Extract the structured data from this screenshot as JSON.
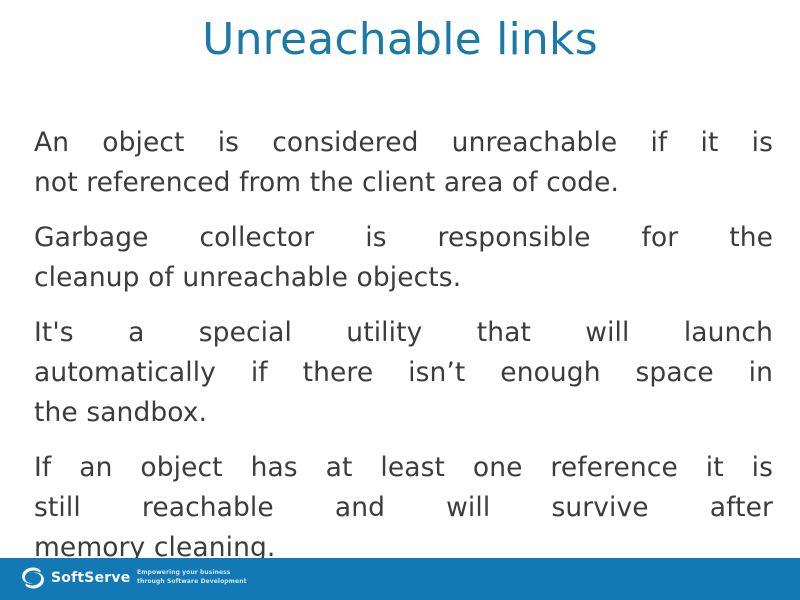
{
  "slide": {
    "title": "Unreachable links",
    "title_color": "#1b7aa8",
    "body_color": "#3c3c3c",
    "background_color": "#ffffff",
    "paragraphs": [
      {
        "text": "An object is considered unreachable if it is not referenced from the client area of code.",
        "lines": [
          "An object is considered unreachable if it is",
          "not referenced from the client area of code."
        ]
      },
      {
        "text": "Garbage collector is responsible for the cleanup of unreachable objects.",
        "lines": [
          "Garbage collector is responsible for the",
          "cleanup of unreachable objects."
        ]
      },
      {
        "text": "It's a special utility that will launch automatically if there isn’t enough space in the sandbox.",
        "lines": [
          "It's a special utility that will launch",
          "automatically if there isn’t enough space in",
          "the sandbox."
        ]
      },
      {
        "text": "If an object has at least one reference it is still reachable and will survive after memory cleaning.",
        "lines": [
          "If an object has at least one reference it is",
          "still reachable and will survive after",
          "memory cleaning."
        ]
      }
    ]
  },
  "footer": {
    "background_color": "#1379b4",
    "logo_name": "SoftServe",
    "tagline_line1": "Empowering your business",
    "tagline_line2": "through Software Development"
  }
}
